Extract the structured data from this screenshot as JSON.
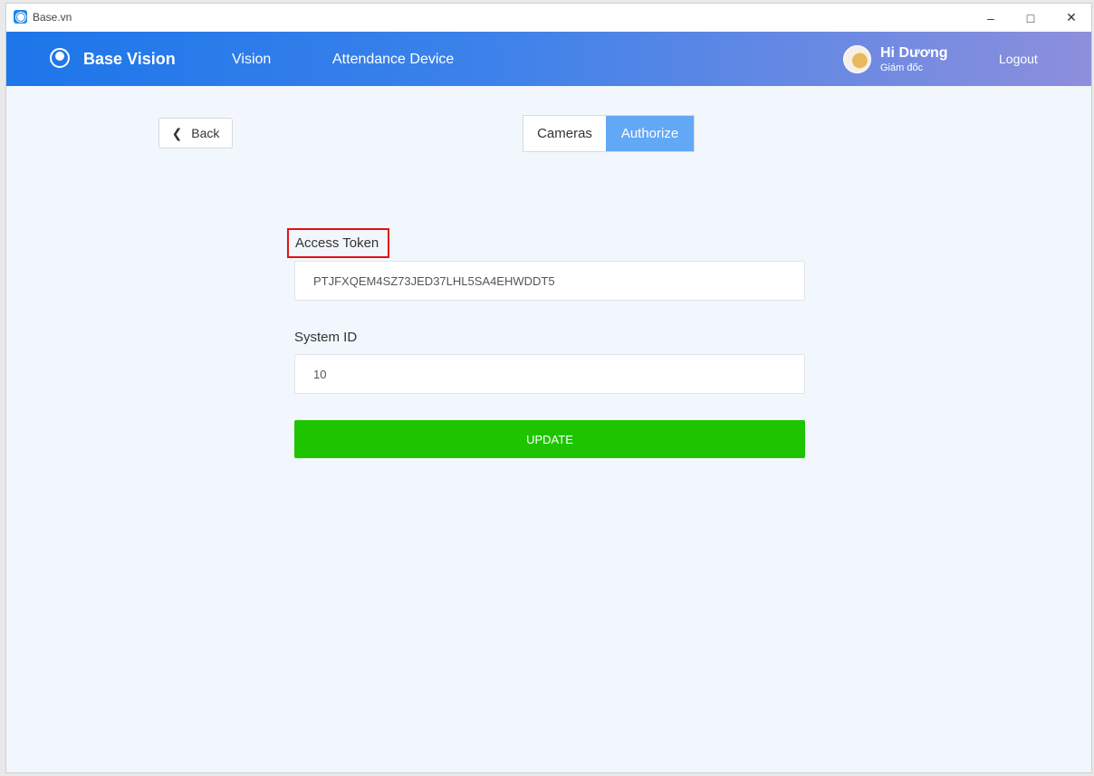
{
  "window": {
    "title": "Base.vn"
  },
  "navbar": {
    "brand": "Base Vision",
    "links": [
      "Vision",
      "Attendance Device"
    ],
    "user": {
      "greeting": "Hi Dương",
      "role": "Giám đốc"
    },
    "logout": "Logout",
    "gradient_colors": [
      "#1d76ea",
      "#8d8fdc"
    ]
  },
  "back": {
    "label": "Back"
  },
  "tabs": [
    {
      "label": "Cameras",
      "active": false
    },
    {
      "label": "Authorize",
      "active": true
    }
  ],
  "form": {
    "access_token": {
      "label": "Access Token",
      "value": "PTJFXQEM4SZ73JED37LHL5SA4EHWDDT5"
    },
    "system_id": {
      "label": "System ID",
      "value": "10"
    },
    "submit": {
      "label": "UPDATE",
      "color": "#1ec400"
    }
  },
  "colors": {
    "active_tab": "#62a8f6",
    "highlight_box": "#e01212"
  }
}
